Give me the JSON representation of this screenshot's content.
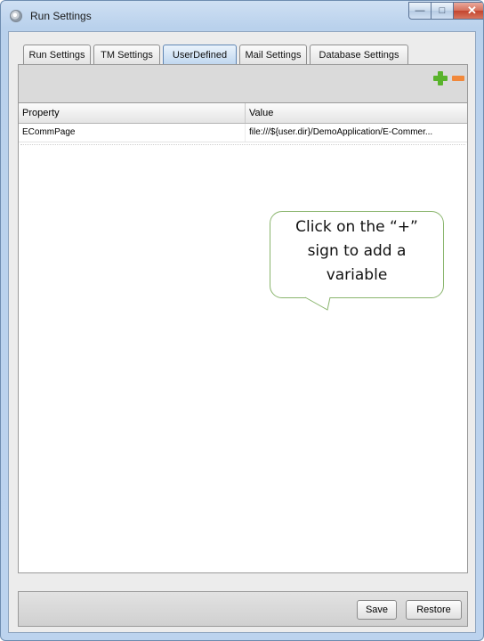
{
  "window": {
    "title": "Run Settings"
  },
  "tabs": [
    {
      "label": "Run Settings",
      "active": false
    },
    {
      "label": "TM Settings",
      "active": false
    },
    {
      "label": "UserDefined",
      "active": true
    },
    {
      "label": "Mail Settings",
      "active": false
    },
    {
      "label": "Database Settings",
      "active": false
    }
  ],
  "toolbar": {
    "add_icon": "plus-icon",
    "remove_icon": "minus-icon",
    "add_color": "#59b32c",
    "remove_color": "#f1883a"
  },
  "table": {
    "columns": [
      "Property",
      "Value"
    ],
    "rows": [
      {
        "property": "ECommPage",
        "value": "file:///${user.dir}/DemoApplication/E-Commer..."
      }
    ]
  },
  "callout": {
    "lines": [
      "Click on the “+”",
      "sign to add a",
      "variable"
    ]
  },
  "footer": {
    "save_label": "Save",
    "restore_label": "Restore"
  }
}
